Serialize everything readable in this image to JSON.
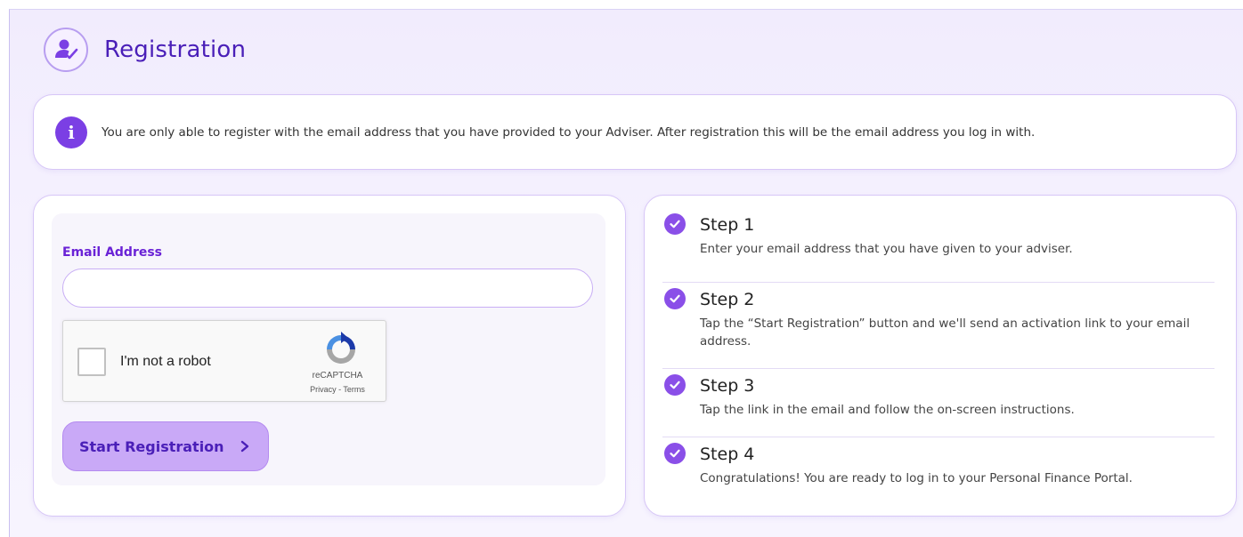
{
  "header": {
    "title": "Registration",
    "icon": "user-check-icon"
  },
  "info": {
    "icon": "info-icon",
    "icon_glyph": "i",
    "text": "You are only able to register with the email address that you have provided to your Adviser. After registration this will be the email address you log in with."
  },
  "form": {
    "email_label": "Email Address",
    "email_value": "",
    "email_placeholder": "",
    "recaptcha": {
      "label": "I'm not a robot",
      "brand": "reCAPTCHA",
      "links": "Privacy - Terms"
    },
    "submit_label": "Start Registration"
  },
  "steps": [
    {
      "title": "Step 1",
      "desc": "Enter your email address that you have given to your adviser."
    },
    {
      "title": "Step 2",
      "desc": "Tap the “Start Registration” button and we'll send an activation link to your email address."
    },
    {
      "title": "Step 3",
      "desc": "Tap the link in the email and follow the on-screen instructions."
    },
    {
      "title": "Step 4",
      "desc": "Congratulations! You are ready to log in to your Personal Finance Portal."
    }
  ],
  "colors": {
    "accent": "#7b3fe4",
    "title": "#4a1fb8",
    "button_bg": "#c9a9f7",
    "border": "#d7c6f7"
  }
}
